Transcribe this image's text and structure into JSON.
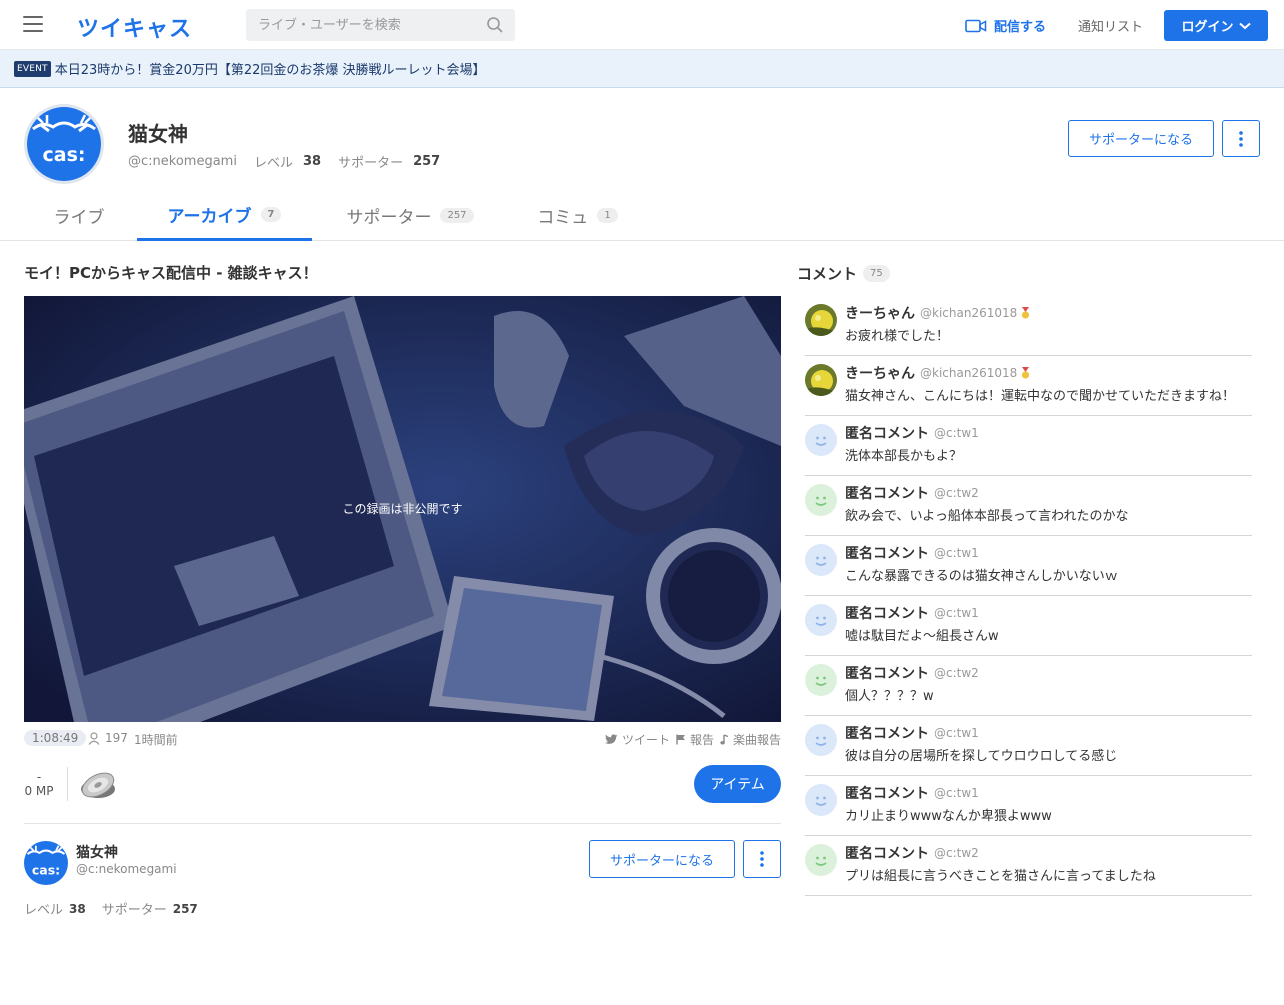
{
  "header": {
    "logo": "ツイキャス",
    "search_placeholder": "ライブ・ユーザーを検索",
    "go_live": "配信する",
    "notifications": "通知リスト",
    "login": "ログイン"
  },
  "event": {
    "badge": "EVENT",
    "text": "本日23時から！賞金20万円【第22回金のお茶爆 決勝戦ルーレット会場】"
  },
  "profile": {
    "name": "猫女神",
    "id": "@c:nekomegami",
    "level_label": "レベル",
    "level": "38",
    "supporters_label": "サポーター",
    "supporters": "257",
    "support_button": "サポーターになる"
  },
  "tabs": [
    {
      "label": "ライブ",
      "count": ""
    },
    {
      "label": "アーカイブ",
      "count": "7"
    },
    {
      "label": "サポーター",
      "count": "257"
    },
    {
      "label": "コミュ",
      "count": "1"
    }
  ],
  "movie": {
    "title": "モイ！PCからキャス配信中 - 雑談キャス！",
    "private_message": "この録画は非公開です",
    "duration": "1:08:49",
    "views": "197",
    "ago": "1時間前",
    "tweet": "ツイート",
    "report": "報告",
    "music_report": "楽曲報告",
    "mp_value": "-",
    "mp_label": "0 MP",
    "item_button": "アイテム"
  },
  "owner": {
    "name": "猫女神",
    "id": "@c:nekomegami",
    "support_button": "サポーターになる",
    "level_label": "レベル",
    "level": "38",
    "supporters_label": "サポーター",
    "supporters": "257"
  },
  "comments_header": {
    "label": "コメント",
    "count": "75"
  },
  "comments": [
    {
      "name": "きーちゃん",
      "id": "@kichan261018",
      "text": "お疲れ様でした！",
      "avatar": "photo",
      "medal": true
    },
    {
      "name": "きーちゃん",
      "id": "@kichan261018",
      "text": "猫女神さん、こんにちは！運転中なので聞かせていただきますね！",
      "avatar": "photo",
      "medal": true
    },
    {
      "name": "匿名コメント",
      "id": "@c:tw1",
      "text": "洗体本部長かもよ？",
      "avatar": "blue",
      "medal": false
    },
    {
      "name": "匿名コメント",
      "id": "@c:tw2",
      "text": "飲み会で、いよっ船体本部長って言われたのかな",
      "avatar": "green",
      "medal": false
    },
    {
      "name": "匿名コメント",
      "id": "@c:tw1",
      "text": "こんな暴露できるのは猫女神さんしかいないｗ",
      "avatar": "blue",
      "medal": false
    },
    {
      "name": "匿名コメント",
      "id": "@c:tw1",
      "text": "嘘は駄目だよ～組長さんw",
      "avatar": "blue",
      "medal": false
    },
    {
      "name": "匿名コメント",
      "id": "@c:tw2",
      "text": "個人？？？？w",
      "avatar": "green",
      "medal": false
    },
    {
      "name": "匿名コメント",
      "id": "@c:tw1",
      "text": "彼は自分の居場所を探してウロウロしてる感じ",
      "avatar": "blue",
      "medal": false
    },
    {
      "name": "匿名コメント",
      "id": "@c:tw1",
      "text": "カリ止まりwwwなんか卑猥よwww",
      "avatar": "blue",
      "medal": false
    },
    {
      "name": "匿名コメント",
      "id": "@c:tw2",
      "text": "プリは組長に言うべきことを猫さんに言ってましたね",
      "avatar": "green",
      "medal": false
    }
  ],
  "colors": {
    "accent": "#1e73e8",
    "event_bg": "#e9f1fb",
    "anon_blue": "#dbe8fa",
    "anon_green": "#dcf1dc"
  }
}
